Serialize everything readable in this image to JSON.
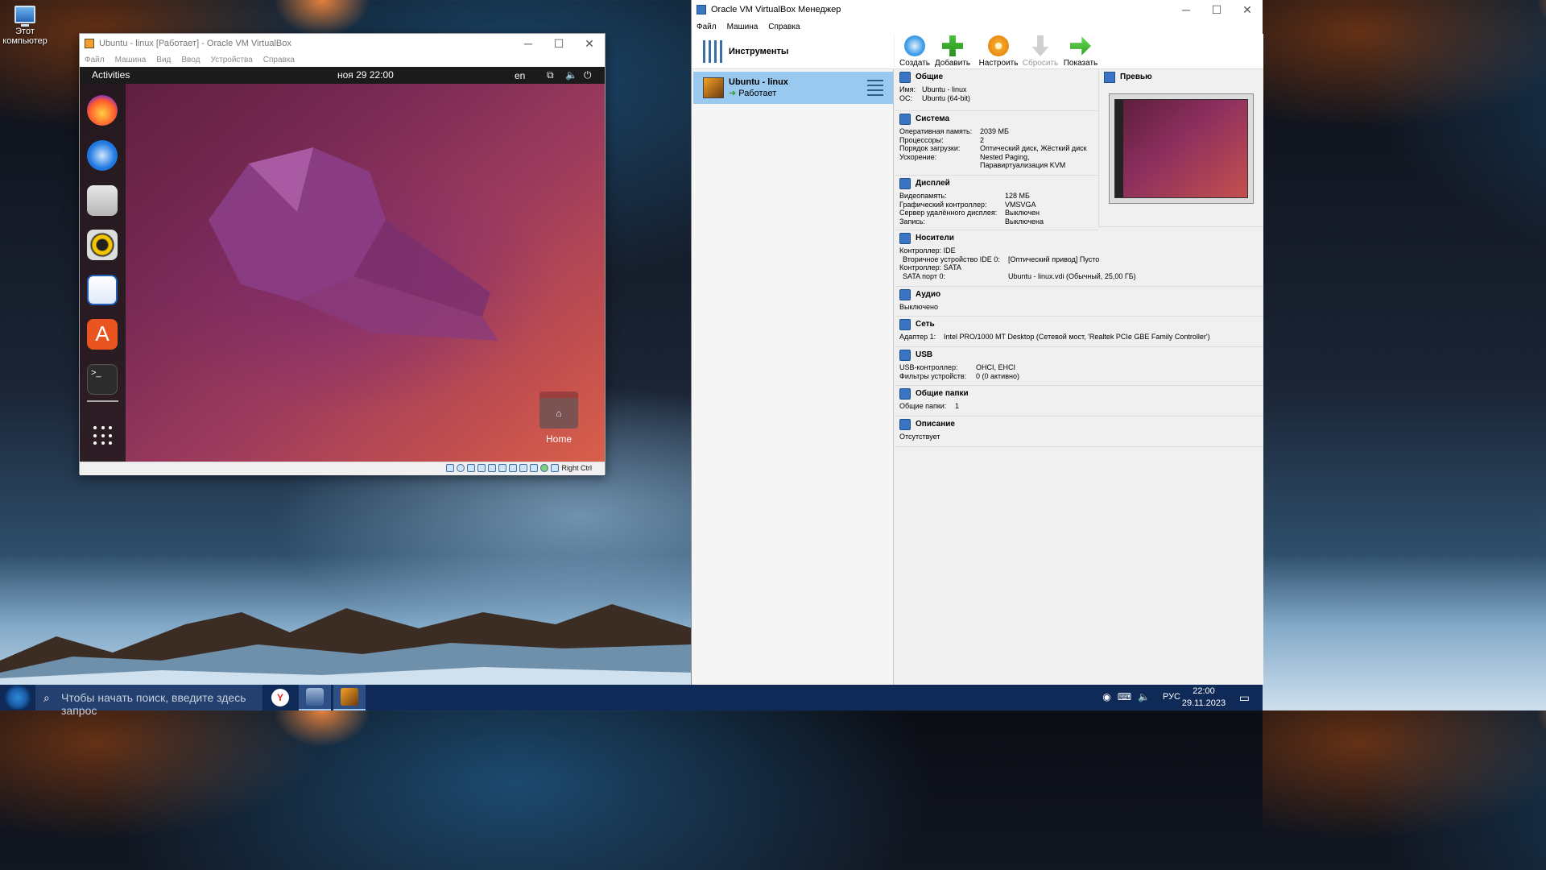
{
  "desktop": {
    "icon_label": "Этот компьютер"
  },
  "vm_window": {
    "title": "Ubuntu - linux [Работает] - Oracle VM VirtualBox",
    "menu": [
      "Файл",
      "Машина",
      "Вид",
      "Ввод",
      "Устройства",
      "Справка"
    ],
    "guest": {
      "activities": "Activities",
      "clock": "ноя 29  22:00",
      "lang": "en",
      "home_label": "Home",
      "dock_apps": [
        "firefox-icon",
        "thunderbird-icon",
        "files-icon",
        "rhythmbox-icon",
        "writer-icon",
        "software-icon",
        "terminal-icon"
      ]
    },
    "host_key": "Right Ctrl"
  },
  "manager": {
    "title": "Oracle VM VirtualBox Менеджер",
    "menu": [
      "Файл",
      "Машина",
      "Справка"
    ],
    "tools_label": "Инструменты",
    "vm": {
      "name": "Ubuntu - linux",
      "state": "Работает"
    },
    "toolbar": [
      {
        "label": "Создать",
        "enabled": true
      },
      {
        "label": "Добавить",
        "enabled": true
      },
      {
        "label": "Настроить",
        "enabled": true
      },
      {
        "label": "Сбросить",
        "enabled": false
      },
      {
        "label": "Показать",
        "enabled": true
      }
    ],
    "preview_title": "Превью",
    "sections": {
      "general": {
        "title": "Общие",
        "rows": [
          [
            "Имя:",
            "Ubuntu - linux"
          ],
          [
            "ОС:",
            "Ubuntu (64-bit)"
          ]
        ]
      },
      "system": {
        "title": "Система",
        "rows": [
          [
            "Оперативная память:",
            "2039 МБ"
          ],
          [
            "Процессоры:",
            "2"
          ],
          [
            "Порядок загрузки:",
            "Оптический диск, Жёсткий диск"
          ],
          [
            "Ускорение:",
            "Nested Paging,"
          ],
          [
            "",
            "Паравиртуализация KVM"
          ]
        ]
      },
      "display": {
        "title": "Дисплей",
        "rows": [
          [
            "Видеопамять:",
            "128 МБ"
          ],
          [
            "Графический контроллер:",
            "VMSVGA"
          ],
          [
            "Сервер удалённого дисплея:",
            "Выключен"
          ],
          [
            "Запись:",
            "Выключена"
          ]
        ]
      },
      "storage": {
        "title": "Носители",
        "rows": [
          [
            "Контроллер: IDE",
            ""
          ],
          [
            " Вторичное устройство IDE 0:",
            "[Оптический привод] Пусто"
          ],
          [
            "Контроллер: SATA",
            ""
          ],
          [
            " SATA порт 0:",
            "Ubuntu - linux.vdi (Обычный, 25,00 ГБ)"
          ]
        ]
      },
      "audio": {
        "title": "Аудио",
        "rows": [
          [
            "Выключено",
            ""
          ]
        ]
      },
      "network": {
        "title": "Сеть",
        "rows": [
          [
            "Адаптер 1:",
            "Intel PRO/1000 MT Desktop (Сетевой мост, 'Realtek PCIe GBE Family Controller')"
          ]
        ]
      },
      "usb": {
        "title": "USB",
        "rows": [
          [
            "USB-контроллер:",
            "OHCI, EHCI"
          ],
          [
            "Фильтры устройств:",
            "0 (0 активно)"
          ]
        ]
      },
      "shared": {
        "title": "Общие папки",
        "rows": [
          [
            "Общие папки:",
            "1"
          ]
        ]
      },
      "description": {
        "title": "Описание",
        "rows": [
          [
            "Отсутствует",
            ""
          ]
        ]
      }
    }
  },
  "taskbar": {
    "search_placeholder": "Чтобы начать поиск, введите здесь запрос",
    "lang": "РУС",
    "time": "22:00",
    "date": "29.11.2023"
  }
}
